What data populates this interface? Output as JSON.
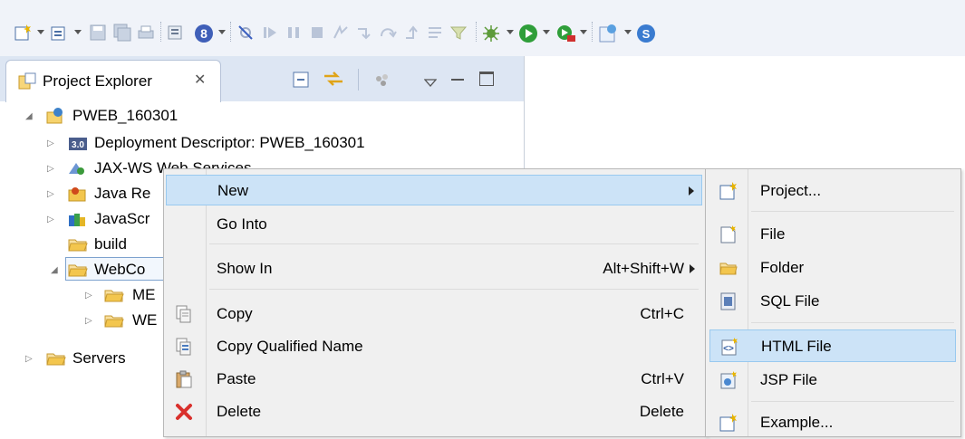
{
  "toolbar": {
    "icons": [
      "new-wizard-icon",
      "new-server-icon",
      "save-icon",
      "save-all-icon",
      "print-icon",
      "open-type-icon",
      "web-browser-icon",
      "skip-breakpoints-icon",
      "resume-icon",
      "suspend-icon",
      "terminate-icon",
      "disconnect-icon",
      "step-into-icon",
      "step-over-icon",
      "step-return-icon",
      "drop-to-frame-icon",
      "use-step-filters-icon",
      "debug-icon",
      "run-icon",
      "external-tools-icon",
      "new-java-class-icon",
      "server-start-icon"
    ]
  },
  "explorer": {
    "title": "Project Explorer",
    "close_glyph": "✕",
    "tree": [
      {
        "label": "PWEB_160301",
        "icon": "web-project-icon"
      },
      {
        "label": "Deployment Descriptor: PWEB_160301",
        "icon": "deployment-descriptor-icon"
      },
      {
        "label": "JAX-WS Web Services",
        "icon": "web-services-icon"
      },
      {
        "label": "Java Re",
        "icon": "java-resources-icon"
      },
      {
        "label": "JavaScr",
        "icon": "javascript-resources-icon"
      },
      {
        "label": "build",
        "icon": "folder-icon"
      },
      {
        "label": "WebCo",
        "icon": "folder-icon"
      },
      {
        "label": "ME",
        "icon": "folder-icon"
      },
      {
        "label": "WE",
        "icon": "folder-icon"
      },
      {
        "label": "Servers",
        "icon": "folder-icon"
      }
    ]
  },
  "context_menu": {
    "items": [
      {
        "label": "New",
        "shortcut": "",
        "submenu": true,
        "icon": ""
      },
      {
        "label": "Go Into",
        "shortcut": "",
        "icon": ""
      },
      {
        "label": "Show In",
        "shortcut": "Alt+Shift+W",
        "submenu": true,
        "icon": ""
      },
      {
        "label": "Copy",
        "shortcut": "Ctrl+C",
        "icon": "copy-icon"
      },
      {
        "label": "Copy Qualified Name",
        "shortcut": "",
        "icon": "copy-qualified-name-icon"
      },
      {
        "label": "Paste",
        "shortcut": "Ctrl+V",
        "icon": "paste-icon"
      },
      {
        "label": "Delete",
        "shortcut": "Delete",
        "icon": "delete-icon"
      }
    ]
  },
  "new_submenu": {
    "items": [
      {
        "label": "Project...",
        "icon": "new-project-icon"
      },
      {
        "label": "File",
        "icon": "new-file-icon"
      },
      {
        "label": "Folder",
        "icon": "new-folder-icon"
      },
      {
        "label": "SQL File",
        "icon": "sql-file-icon"
      },
      {
        "label": "HTML File",
        "icon": "html-file-icon"
      },
      {
        "label": "JSP File",
        "icon": "jsp-file-icon"
      },
      {
        "label": "Example...",
        "icon": "example-icon"
      }
    ]
  },
  "colors": {
    "highlight": "#cce3f7",
    "highlight_border": "#99c9ef",
    "menu_bg": "#f0f0f0",
    "delete_red": "#d9302c",
    "folder_yellow": "#f3c64e"
  }
}
